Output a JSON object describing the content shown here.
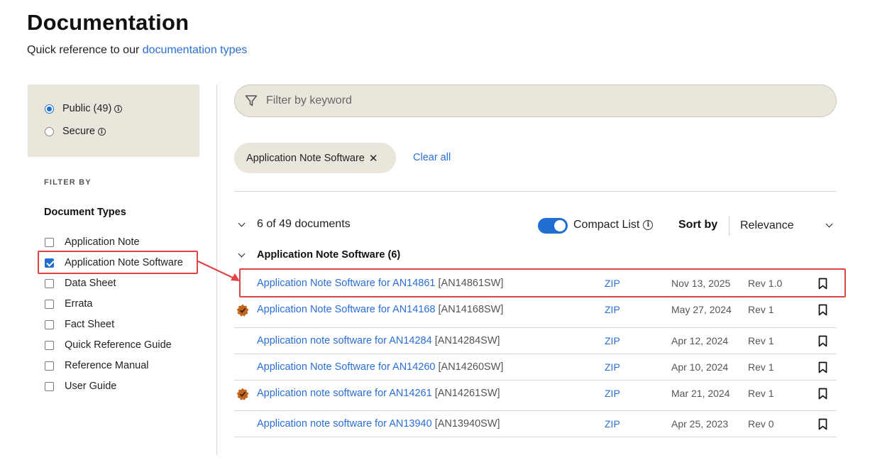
{
  "header": {
    "title": "Documentation",
    "subtitle_prefix": "Quick reference to our ",
    "subtitle_link": "documentation types"
  },
  "access": {
    "options": [
      {
        "label": "Public (49)",
        "checked": true
      },
      {
        "label": "Secure",
        "checked": false
      }
    ]
  },
  "sidebar": {
    "filter_by_label": "FILTER BY",
    "doc_types_heading": "Document Types",
    "doc_types": [
      {
        "label": "Application Note",
        "checked": false
      },
      {
        "label": "Application Note Software",
        "checked": true
      },
      {
        "label": "Data Sheet",
        "checked": false
      },
      {
        "label": "Errata",
        "checked": false
      },
      {
        "label": "Fact Sheet",
        "checked": false
      },
      {
        "label": "Quick Reference Guide",
        "checked": false
      },
      {
        "label": "Reference Manual",
        "checked": false
      },
      {
        "label": "User Guide",
        "checked": false
      }
    ]
  },
  "search": {
    "placeholder": "Filter by keyword"
  },
  "active_filters": {
    "chip_label": "Application Note Software",
    "clear_all_label": "Clear all"
  },
  "results": {
    "count_text": "6 of 49 documents",
    "compact_list_label": "Compact List",
    "compact_list_on": true,
    "sort_label": "Sort by",
    "sort_value": "Relevance",
    "group_label": "Application Note Software (6)",
    "rows": [
      {
        "title": "Application Note Software for AN14861",
        "code": "[AN14861SW]",
        "format": "ZIP",
        "date": "Nov 13, 2025",
        "rev": "Rev 1.0",
        "badge": false
      },
      {
        "title": "Application Note Software for AN14168",
        "code": "[AN14168SW]",
        "format": "ZIP",
        "date": "May 27, 2024",
        "rev": "Rev 1",
        "badge": true
      },
      {
        "title": "Application note software for AN14284",
        "code": "[AN14284SW]",
        "format": "ZIP",
        "date": "Apr 12, 2024",
        "rev": "Rev 1",
        "badge": false
      },
      {
        "title": "Application Note Software for AN14260",
        "code": "[AN14260SW]",
        "format": "ZIP",
        "date": "Apr 10, 2024",
        "rev": "Rev 1",
        "badge": false
      },
      {
        "title": "Application note software for AN14261",
        "code": "[AN14261SW]",
        "format": "ZIP",
        "date": "Mar 21, 2024",
        "rev": "Rev 1",
        "badge": true
      },
      {
        "title": "Application note software for AN13940",
        "code": "[AN13940SW]",
        "format": "ZIP",
        "date": "Apr 25, 2023",
        "rev": "Rev 0",
        "badge": false
      }
    ]
  },
  "colors": {
    "accent": "#1f6fd0",
    "link": "#2a6fd6",
    "panel": "#ebe6dc",
    "highlight": "#e04545",
    "badge": "#c0661f"
  }
}
